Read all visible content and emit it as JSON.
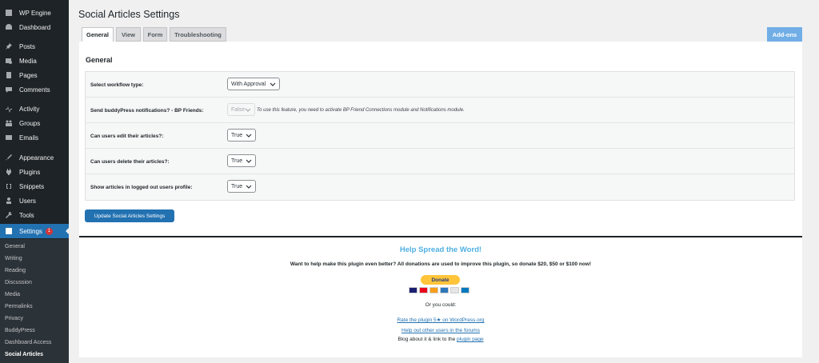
{
  "sidebar": {
    "brand": "WP Engine",
    "items": [
      {
        "label": "Dashboard",
        "icon": "dashboard-icon"
      },
      {
        "label": "Posts",
        "icon": "pin-icon"
      },
      {
        "label": "Media",
        "icon": "media-icon"
      },
      {
        "label": "Pages",
        "icon": "page-icon"
      },
      {
        "label": "Comments",
        "icon": "comment-icon"
      },
      {
        "label": "Activity",
        "icon": "activity-icon"
      },
      {
        "label": "Groups",
        "icon": "groups-icon"
      },
      {
        "label": "Emails",
        "icon": "email-icon"
      },
      {
        "label": "Appearance",
        "icon": "brush-icon"
      },
      {
        "label": "Plugins",
        "icon": "plugin-icon"
      },
      {
        "label": "Snippets",
        "icon": "snippet-icon"
      },
      {
        "label": "Users",
        "icon": "user-icon"
      },
      {
        "label": "Tools",
        "icon": "wrench-icon"
      },
      {
        "label": "Settings",
        "icon": "settings-icon",
        "badge": "1"
      }
    ],
    "submenu": [
      "General",
      "Writing",
      "Reading",
      "Discussion",
      "Media",
      "Permalinks",
      "Privacy",
      "BuddyPress",
      "Dashboard Access",
      "Social Articles"
    ]
  },
  "page": {
    "title": "Social Articles Settings",
    "tabs": [
      "General",
      "View",
      "Form",
      "Troubleshooting"
    ],
    "addons": "Add-ons",
    "section_title": "General"
  },
  "settings": [
    {
      "label": "Select workflow type:",
      "value": "With Approval"
    },
    {
      "label": "Send buddyPress notifications? - BP Friends:",
      "value": "False",
      "note": "To use this feature, you need to activate BP Friend Connections module and Notifications module."
    },
    {
      "label": "Can users edit their articles?:",
      "value": "True"
    },
    {
      "label": "Can users delete their articles?:",
      "value": "True"
    },
    {
      "label": "Show articles in logged out users profile:",
      "value": "True"
    }
  ],
  "update_button": "Update Social Articles Settings",
  "spread": {
    "title": "Help Spread the Word!",
    "text": "Want to help make this plugin even better? All donations are used to improve this plugin, so donate $20, $50 or $100 now!",
    "donate": "Donate",
    "or": "Or you could:",
    "rate_link": "Rate the plugin 5★ on WordPress.org",
    "help_link": "Help out other users in the forums",
    "blog_prefix": "Blog about it & link to the ",
    "blog_link": "plugin page"
  },
  "colors": {
    "accent": "#2271b1",
    "sidebar": "#1d2327",
    "addons": "#72aee6",
    "spread_title": "#4fb0e3",
    "donate": "#ffc439"
  }
}
